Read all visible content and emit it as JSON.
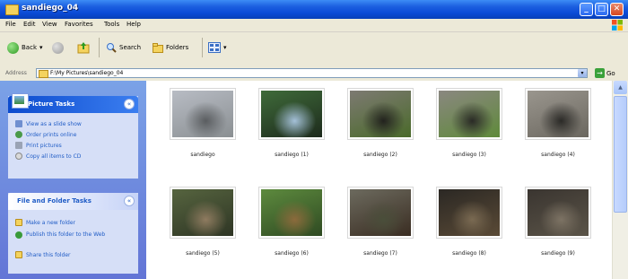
{
  "window": {
    "title": "sandiego_04",
    "buttons": {
      "minimize": "_",
      "maximize": "□",
      "close": "✕"
    }
  },
  "menu": [
    "File",
    "Edit",
    "View",
    "Favorites",
    "Tools",
    "Help"
  ],
  "toolbar": {
    "back_label": "Back",
    "search_label": "Search",
    "folders_label": "Folders",
    "back_arrow": "▾",
    "views_arrow": "▾"
  },
  "address": {
    "label": "Address",
    "path": "F:\\My Pictures\\sandiego_04",
    "go_label": "Go",
    "go_arrow": "→",
    "dropdown_arrow": "▾"
  },
  "picture_tasks": {
    "title": "Picture Tasks",
    "collapse_glyph": "«",
    "items": [
      "View as a slide show",
      "Order prints online",
      "Print pictures",
      "Copy all items to CD"
    ]
  },
  "file_folder_tasks": {
    "title": "File and Folder Tasks",
    "collapse_glyph": "«",
    "items": [
      "Make a new folder",
      "Publish this folder to the Web",
      "Share this folder"
    ]
  },
  "scroll": {
    "up_glyph": "▲"
  },
  "thumbnails": [
    {
      "label": "sandiego",
      "palette": [
        "#b8bcc4",
        "#8a8f92",
        "#5a5d60"
      ]
    },
    {
      "label": "sandiego (1)",
      "palette": [
        "#3f6b3a",
        "#1d2a1c",
        "#a4c0d8"
      ]
    },
    {
      "label": "sandiego (2)",
      "palette": [
        "#7d7a72",
        "#4a6a2a",
        "#22221e"
      ]
    },
    {
      "label": "sandiego (3)",
      "palette": [
        "#8a8780",
        "#5f8a3a",
        "#2a2a26"
      ]
    },
    {
      "label": "sandiego (4)",
      "palette": [
        "#9a968e",
        "#6b675f",
        "#2b2a27"
      ]
    },
    {
      "label": "sandiego (5)",
      "palette": [
        "#56643f",
        "#2e3524",
        "#8f7b60"
      ]
    },
    {
      "label": "sandiego (6)",
      "palette": [
        "#5d8a3e",
        "#2f4a22",
        "#8c6a3c"
      ]
    },
    {
      "label": "sandiego (7)",
      "palette": [
        "#6c6a5e",
        "#3a2d22",
        "#4a4e3a"
      ]
    },
    {
      "label": "sandiego (8)",
      "palette": [
        "#2b2824",
        "#5a4a36",
        "#7a6a52"
      ]
    },
    {
      "label": "sandiego (9)",
      "palette": [
        "#3a3530",
        "#5b5448",
        "#7d7364"
      ]
    }
  ]
}
